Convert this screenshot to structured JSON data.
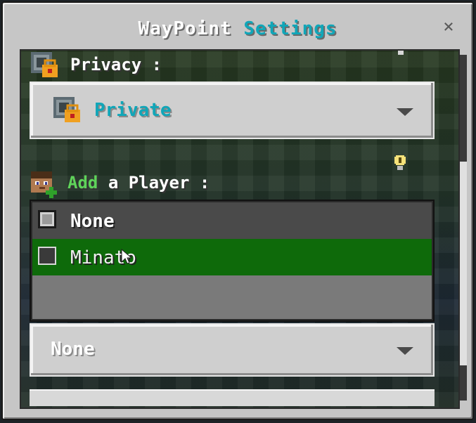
{
  "dialog": {
    "title_part1": "WayPoint",
    "title_part2": "Settings",
    "close_glyph": "×"
  },
  "privacy": {
    "label": "Privacy :",
    "selected": "Private",
    "icon": "lock-icon"
  },
  "add_player": {
    "label_highlight": "Add",
    "label_rest": "a Player :",
    "icon": "player-add-icon"
  },
  "player_list": {
    "items": [
      {
        "label": "None",
        "checked": true,
        "state": "default"
      },
      {
        "label": "Minato",
        "checked": false,
        "state": "hovered"
      }
    ]
  },
  "player_select": {
    "selected": "None"
  },
  "colors": {
    "accent": "#10a6b8",
    "add_green": "#5fd35a",
    "hover_row": "#0e6a0a",
    "row_bg": "#4a4a4a"
  }
}
